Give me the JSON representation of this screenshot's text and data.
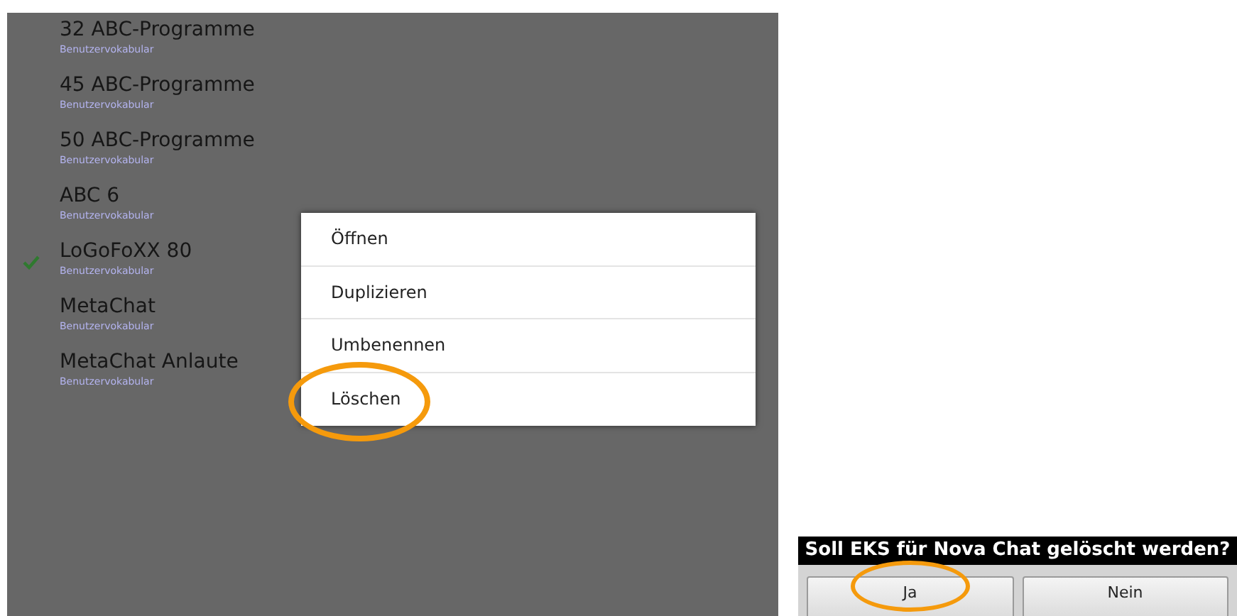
{
  "vocabularies": [
    {
      "title": "32 ABC-Programme",
      "subtitle": "Benutzervokabular",
      "selected": false
    },
    {
      "title": "45 ABC-Programme",
      "subtitle": "Benutzervokabular",
      "selected": false
    },
    {
      "title": "50 ABC-Programme",
      "subtitle": "Benutzervokabular",
      "selected": false
    },
    {
      "title": "ABC 6",
      "subtitle": "Benutzervokabular",
      "selected": false
    },
    {
      "title": "LoGoFoXX 80",
      "subtitle": "Benutzervokabular",
      "selected": true
    },
    {
      "title": "MetaChat",
      "subtitle": "Benutzervokabular",
      "selected": false
    },
    {
      "title": "MetaChat Anlaute",
      "subtitle": "Benutzervokabular",
      "selected": false
    }
  ],
  "context_menu": [
    {
      "label": "Öffnen",
      "highlighted": false
    },
    {
      "label": "Duplizieren",
      "highlighted": false
    },
    {
      "label": "Umbenennen",
      "highlighted": false
    },
    {
      "label": "Löschen",
      "highlighted": true
    }
  ],
  "dialog": {
    "title": "Soll EKS für Nova Chat gelöscht werden?",
    "buttons": [
      {
        "label": "Ja",
        "highlighted": true
      },
      {
        "label": "Nein",
        "highlighted": false
      }
    ]
  }
}
